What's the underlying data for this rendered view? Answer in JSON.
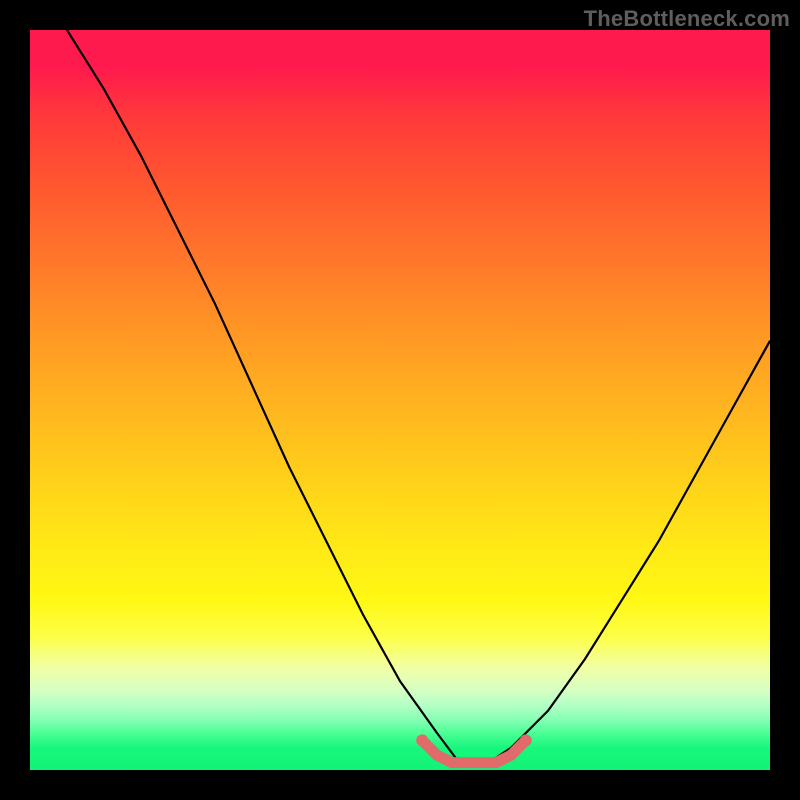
{
  "branding": {
    "watermark": "TheBottleneck.com"
  },
  "chart_data": {
    "type": "line",
    "title": "",
    "xlabel": "",
    "ylabel": "",
    "xlim": [
      0,
      100
    ],
    "ylim": [
      0,
      100
    ],
    "grid": false,
    "background": "gradient-red-yellow-green",
    "series": [
      {
        "name": "bottleneck-curve",
        "color": "#000000",
        "x": [
          5,
          10,
          15,
          20,
          25,
          30,
          35,
          40,
          45,
          50,
          55,
          58,
          62,
          65,
          70,
          75,
          80,
          85,
          90,
          95,
          100
        ],
        "y": [
          100,
          92,
          83,
          73,
          63,
          52,
          41,
          31,
          21,
          12,
          5,
          1,
          1,
          3,
          8,
          15,
          23,
          31,
          40,
          49,
          58
        ]
      },
      {
        "name": "optimal-range-marker",
        "color": "#e16a6a",
        "x": [
          53,
          55,
          57,
          59,
          61,
          63,
          65,
          67
        ],
        "y": [
          4,
          2,
          1,
          1,
          1,
          1,
          2,
          4
        ]
      }
    ],
    "annotations": []
  }
}
